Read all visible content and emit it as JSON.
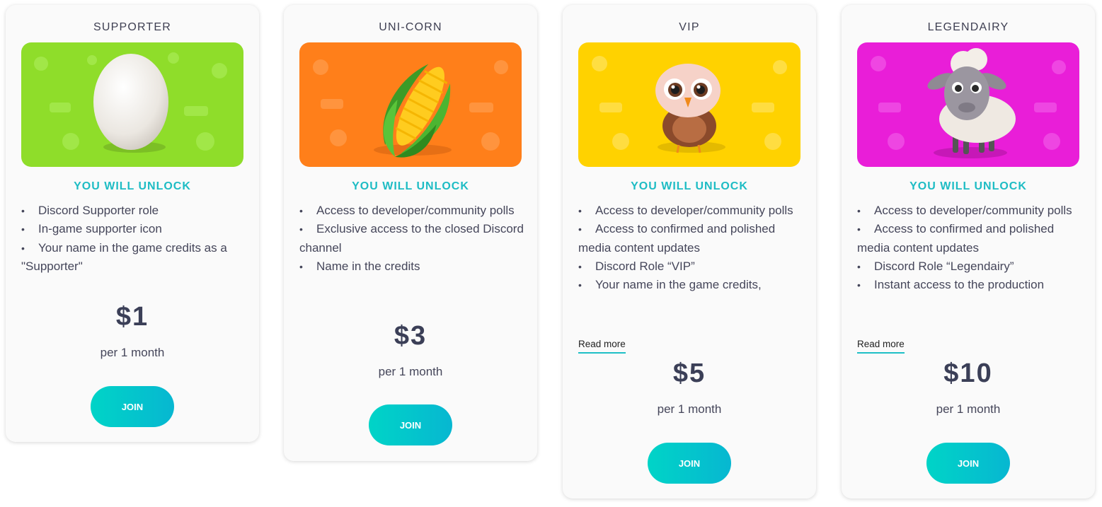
{
  "tiers": [
    {
      "title": "SUPPORTER",
      "image": "egg-illustration",
      "banner_color": "#8fdd2a",
      "unlock_heading": "YOU WILL UNLOCK",
      "perks": [
        "Discord Supporter role",
        "In-game supporter icon",
        "Your name in the game credits as a \"Supporter\""
      ],
      "read_more": "",
      "price": "$1",
      "period": "per 1 month",
      "join_label": "JOIN"
    },
    {
      "title": "UNI-CORN",
      "image": "corn-illustration",
      "banner_color": "#ff7f1a",
      "unlock_heading": "YOU WILL UNLOCK",
      "perks": [
        "Access to developer/community polls",
        "Exclusive access to the closed Discord channel",
        "Name in the credits"
      ],
      "read_more": "",
      "price": "$3",
      "period": "per 1 month",
      "join_label": "JOIN"
    },
    {
      "title": "VIP",
      "image": "owl-illustration",
      "banner_color": "#ffd200",
      "unlock_heading": "YOU WILL UNLOCK",
      "perks": [
        "Access to developer/community polls",
        "Access to confirmed and polished media content updates",
        "Discord Role “VIP”",
        "Your name in the game credits,"
      ],
      "read_more": "Read more",
      "price": "$5",
      "period": "per 1 month",
      "join_label": "JOIN"
    },
    {
      "title": "LEGENDAIRY",
      "image": "sheep-illustration",
      "banner_color": "#e91ed8",
      "unlock_heading": "YOU WILL UNLOCK",
      "perks": [
        "Access to developer/community polls",
        "Access to confirmed and polished media content updates",
        "Discord Role “Legendairy”",
        "Instant access to the production"
      ],
      "read_more": "Read more",
      "price": "$10",
      "period": "per 1 month",
      "join_label": "JOIN"
    }
  ],
  "colors": {
    "accent": "#1ebcc4",
    "join_gradient_start": "#00d4c7",
    "join_gradient_end": "#07b7d1",
    "text": "#45465a",
    "price": "#3b3f57"
  }
}
